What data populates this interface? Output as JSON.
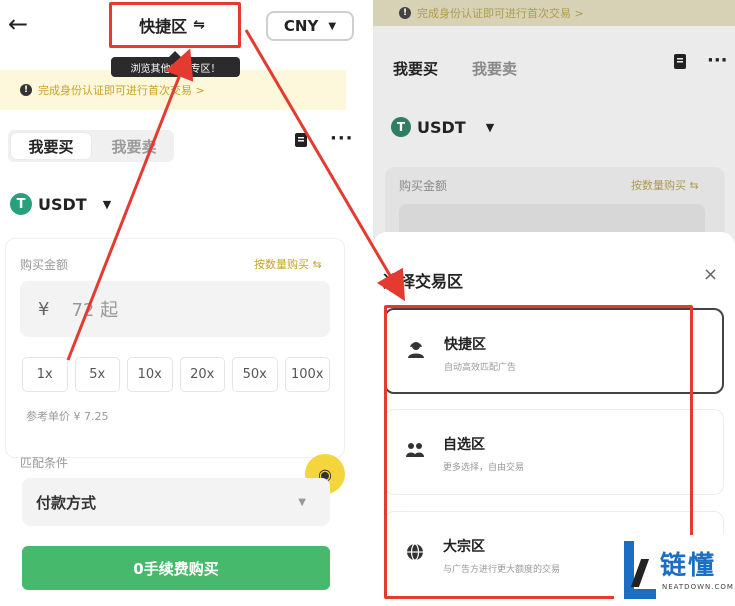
{
  "left": {
    "header": {
      "trade_zone_label": "快捷区",
      "swap_glyph": "⇋",
      "currency": "CNY"
    },
    "tooltip": "浏览其他交易专区！",
    "notice": "完成身份认证即可进行首次交易 >",
    "tabs": [
      {
        "label": "我要买",
        "active": true
      },
      {
        "label": "我要卖",
        "active": false
      }
    ],
    "coin": {
      "symbol": "USDT",
      "glyph": "T"
    },
    "buy_amount_label": "购买金额",
    "buy_by_quantity": "按数量购买 ⇆",
    "amount_input": {
      "currency_symbol": "¥",
      "placeholder": "72 起"
    },
    "multipliers": [
      "1x",
      "5x",
      "10x",
      "20x",
      "50x",
      "100x"
    ],
    "reference_price": "参考单价 ¥ 7.25",
    "match_condition_label": "匹配条件",
    "payment_method": "付款方式",
    "buy_button": "0手续费购买"
  },
  "right": {
    "notice": "完成身份认证即可进行首次交易 >",
    "tabs": [
      {
        "label": "我要买",
        "active": true
      },
      {
        "label": "我要卖",
        "active": false
      }
    ],
    "coin": {
      "symbol": "USDT",
      "glyph": "T"
    },
    "buy_amount_label": "购买金额",
    "buy_by_quantity": "按数量购买 ⇆",
    "sheet": {
      "title": "选择交易区",
      "close_glyph": "×",
      "zones": [
        {
          "title": "快捷区",
          "desc": "自动高效匹配广告",
          "icon": "user-headset-icon",
          "selected": true
        },
        {
          "title": "自选区",
          "desc": "更多选择，自由交易",
          "icon": "users-icon",
          "selected": false
        },
        {
          "title": "大宗区",
          "desc": "与广告方进行更大额度的交易",
          "icon": "globe-icon",
          "selected": false
        }
      ]
    }
  },
  "watermark": {
    "text": "链懂",
    "sub": "NEATDOWN.COM"
  },
  "colors": {
    "accent_green": "#46b96c",
    "annotation_red": "#e43a30",
    "notice_gold": "#c9a227",
    "fab_yellow": "#f4d53b",
    "tether_green": "#26a17b",
    "watermark_blue": "#1a6fc4"
  }
}
